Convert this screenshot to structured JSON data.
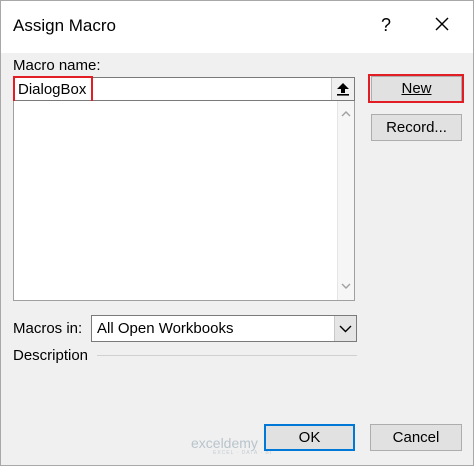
{
  "dialog": {
    "title": "Assign Macro",
    "help_label": "?",
    "macro_name_label": "Macro name:",
    "macro_name_value": "DialogBox",
    "new_button": "New",
    "record_button": "Record...",
    "macros_in_label": "Macros in:",
    "macros_in_value": "All Open Workbooks",
    "description_label": "Description",
    "ok_button": "OK",
    "cancel_button": "Cancel",
    "highlight_color": "#e21d24",
    "focus_color": "#0078d7"
  },
  "icons": {
    "close": "close-icon",
    "collapse": "collapse-dialog-icon",
    "dropdown": "chevron-down-icon",
    "scroll_up": "scroll-up-icon",
    "scroll_down": "scroll-down-icon"
  },
  "watermark": {
    "name": "exceldemy",
    "tagline": "EXCEL · DATA · BI"
  }
}
